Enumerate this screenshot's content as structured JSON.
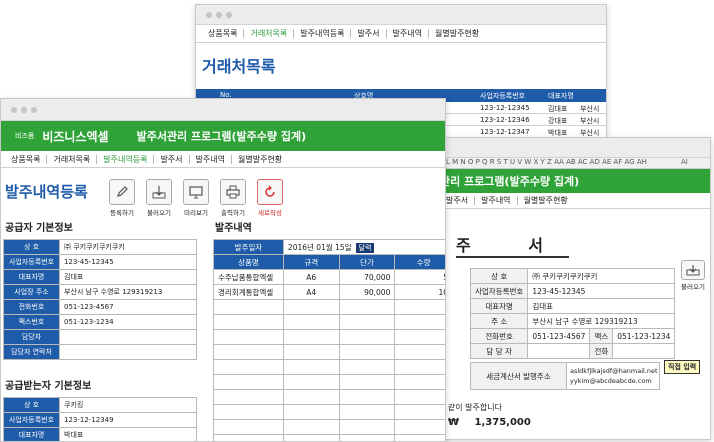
{
  "back_window": {
    "nav": [
      "상품목록",
      "거래처목록",
      "발주내역등록",
      "발주서",
      "발주내역",
      "월별발주현황"
    ],
    "active_index": 1,
    "title": "거래처목록",
    "columns": [
      "No.",
      "상호명",
      "사업자등록번호",
      "대표자명"
    ],
    "rows": [
      {
        "no": "",
        "name": "",
        "reg": "123-12-12345",
        "rep": "김대표",
        "addr": "부산시"
      },
      {
        "no": "",
        "name": "",
        "reg": "123-12-12346",
        "rep": "강대표",
        "addr": "부산시"
      },
      {
        "no": "",
        "name": "",
        "reg": "123-12-12347",
        "rep": "박대표",
        "addr": "부산시"
      },
      {
        "no": "",
        "name": "",
        "reg": "123-12-12348",
        "rep": "이대표",
        "addr": "부산시"
      }
    ]
  },
  "mid_window": {
    "col_letters": "L M N O P Q R S T U V W X Y Z AA AB AC AD AE AF AG AH",
    "ai_label": "AI",
    "title": "관리 프로그램(발주수량 집계)",
    "nav": [
      "발주서",
      "발주내역",
      "월별발주현황"
    ],
    "doc_title": "주 서",
    "print_label": "불러오기",
    "supplier": [
      {
        "label": "상 호",
        "value": "㈜ 쿠키쿠키쿠키쿠키"
      },
      {
        "label": "사업자등록번호",
        "value": "123-45-12345"
      },
      {
        "label": "대표자명",
        "value": "김대표"
      },
      {
        "label": "주 소",
        "value": "부산시 남구 수영로 129319213"
      },
      {
        "label": "전화번호",
        "value": "051-123-4567",
        "label2": "팩스",
        "value2": "051-123-1234"
      },
      {
        "label": "담 당 자",
        "value": "",
        "label2": "전화",
        "value2": ""
      }
    ],
    "tax_label": "세금계산서 발행주소",
    "tax_emails": [
      "asldkfjlkajsdf@hanmail.net",
      "yykim@abcdeabcde.com"
    ],
    "callout": "직접 입력",
    "footer_text": "와 같이 발주합니다",
    "amount_symbol": "₩",
    "amount": "1,375,000"
  },
  "front_window": {
    "brand_small": "비즈폼",
    "brand": "비즈니스엑셀",
    "title": "발주서관리 프로그램(발주수량 집계)",
    "nav": [
      "상품목록",
      "거래처목록",
      "발주내역등록",
      "발주서",
      "발주내역",
      "월별발주현황"
    ],
    "active_index": 2,
    "page_title": "발주내역등록",
    "toolbar": [
      {
        "label": "등록하기",
        "icon": "pencil-icon"
      },
      {
        "label": "불러오기",
        "icon": "download-icon"
      },
      {
        "label": "미리보기",
        "icon": "monitor-icon"
      },
      {
        "label": "출력하기",
        "icon": "printer-icon"
      },
      {
        "label": "새로작성",
        "icon": "refresh-icon"
      }
    ],
    "supplier_section": "공급자 기본정보",
    "supplier": [
      {
        "label": "상 호",
        "value": "㈜ 쿠키쿠키쿠키쿠키"
      },
      {
        "label": "사업자등록번호",
        "value": "123-45-12345"
      },
      {
        "label": "대표자명",
        "value": "김대표"
      },
      {
        "label": "사업장 주소",
        "value": "부산시 남구 수영로 129319213"
      },
      {
        "label": "전화번호",
        "value": "051-123-4567"
      },
      {
        "label": "팩스번호",
        "value": "051-123-1234"
      },
      {
        "label": "담당자",
        "value": ""
      },
      {
        "label": "담당자 연락처",
        "value": ""
      }
    ],
    "receiver_section": "공급받는자 기본정보",
    "receiver": [
      {
        "label": "상 호",
        "value": "쿠키킹"
      },
      {
        "label": "사업자등록번호",
        "value": "123-12-12349"
      },
      {
        "label": "대표자명",
        "value": "박대표"
      }
    ],
    "order_section": "발주내역",
    "order_date_label": "발주일자",
    "order_date": "2016년 01월 15일",
    "calendar_button": "달력",
    "order_columns": [
      "상품명",
      "규격",
      "단가",
      "수량"
    ],
    "order_rows": [
      {
        "name": "수주납품통합엑셀",
        "spec": "A6",
        "price": "70,000",
        "qty": "5"
      },
      {
        "name": "경리회계통합엑셀",
        "spec": "A4",
        "price": "90,000",
        "qty": "10"
      }
    ]
  }
}
